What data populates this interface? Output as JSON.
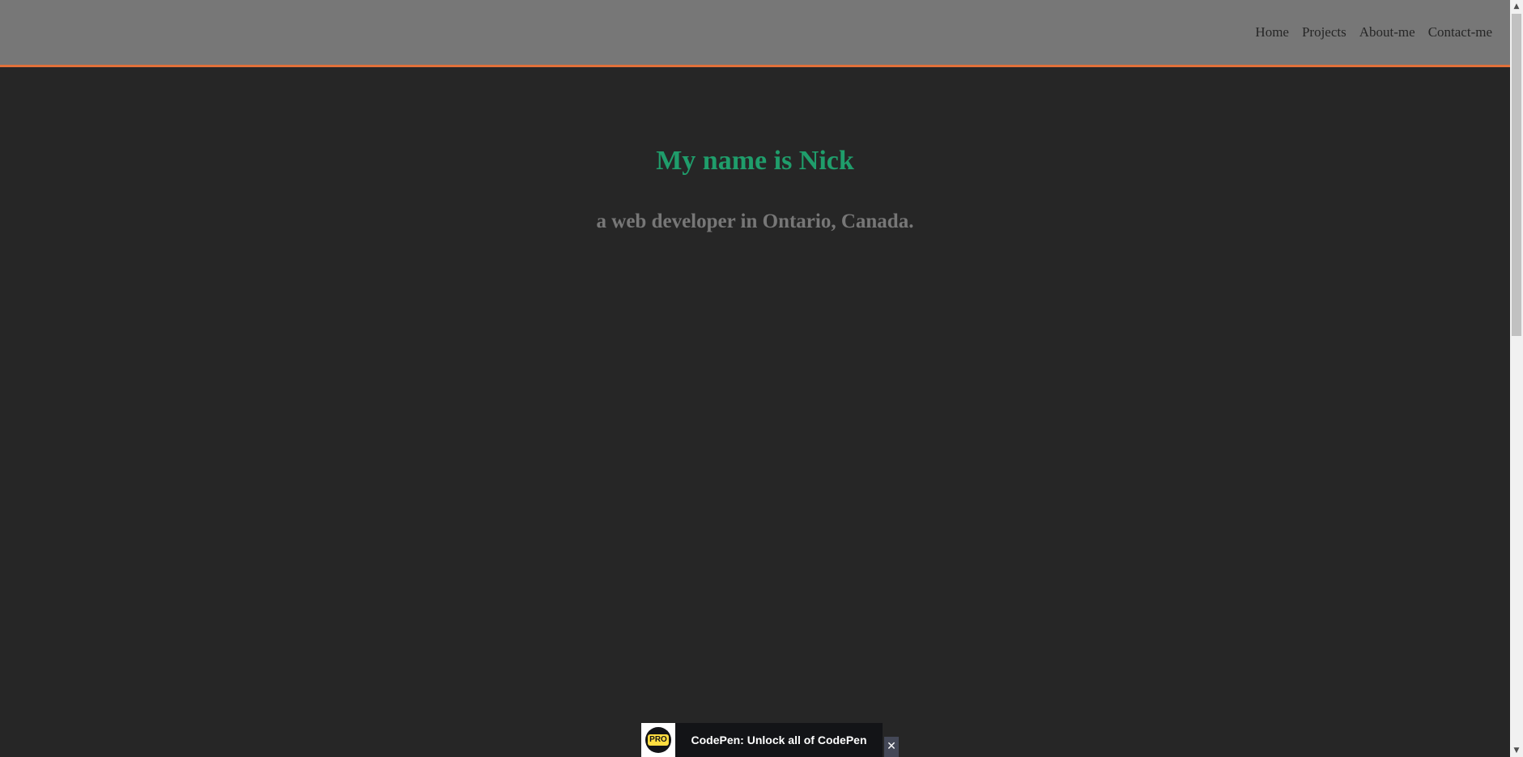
{
  "nav": {
    "links": [
      {
        "label": "Home"
      },
      {
        "label": "Projects"
      },
      {
        "label": "About-me"
      },
      {
        "label": "Contact-me"
      }
    ]
  },
  "hero": {
    "title": "My name is Nick",
    "subtitle": "a web developer in Ontario, Canada."
  },
  "promo": {
    "badge": "PRO",
    "text": "CodePen: Unlock all of CodePen",
    "close": "✕"
  },
  "scrollbar": {
    "up_arrow": "▲",
    "down_arrow": "▼"
  },
  "colors": {
    "background": "#262626",
    "navbar": "#777777",
    "accent": "#e2703a",
    "title": "#1f9d6b",
    "subtitle": "#777777"
  },
  "icons": {
    "promo_badge": "codepen-pro-icon",
    "close": "close-icon"
  }
}
